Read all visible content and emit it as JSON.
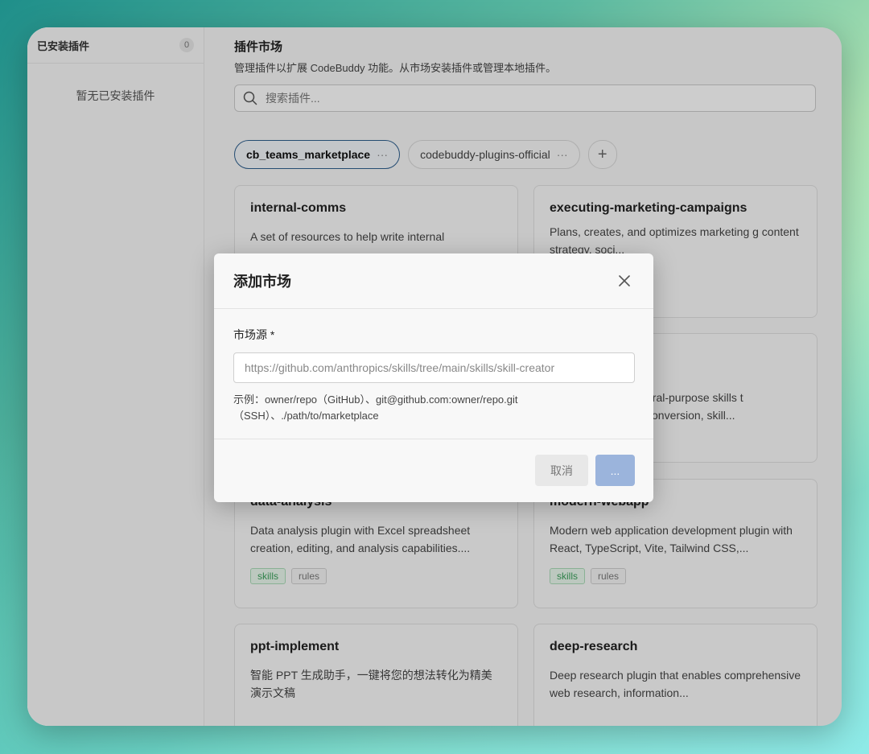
{
  "sidebar": {
    "title": "已安装插件",
    "count": "0",
    "empty": "暂无已安装插件"
  },
  "header": {
    "title": "插件市场",
    "subtitle": "管理插件以扩展 CodeBuddy 功能。从市场安装插件或管理本地插件。"
  },
  "search": {
    "placeholder": "搜索插件..."
  },
  "tabs": [
    {
      "label": "cb_teams_marketplace",
      "more": "···"
    },
    {
      "label": "codebuddy-plugins-official",
      "more": "···"
    }
  ],
  "add_tab": "+",
  "cards": [
    {
      "name": "internal-comms",
      "desc": "A set of resources to help write internal",
      "tags": []
    },
    {
      "name": "executing-marketing-campaigns",
      "desc": "Plans, creates, and optimizes marketing g content strategy, soci...",
      "tags": []
    },
    {
      "name": "",
      "desc": "eral-purpose skills t conversion, skill...",
      "tags": []
    },
    {
      "name": "data-analysis",
      "desc": "Data analysis plugin with Excel spreadsheet creation, editing, and analysis capabilities....",
      "tags": [
        "skills",
        "rules"
      ]
    },
    {
      "name": "modern-webapp",
      "desc": "Modern web application development plugin with React, TypeScript, Vite, Tailwind CSS,...",
      "tags": [
        "skills",
        "rules"
      ]
    },
    {
      "name": "ppt-implement",
      "desc": "智能 PPT 生成助手，一键将您的想法转化为精美演示文稿",
      "tags": []
    },
    {
      "name": "deep-research",
      "desc": "Deep research plugin that enables comprehensive web research, information...",
      "tags": []
    }
  ],
  "modal": {
    "title": "添加市场",
    "label": "市场源 *",
    "placeholder": "https://github.com/anthropics/skills/tree/main/skills/skill-creator",
    "hint": "示例：owner/repo（GitHub）、git@github.com:owner/repo.git（SSH）、./path/to/marketplace",
    "cancel": "取消",
    "confirm": "..."
  }
}
